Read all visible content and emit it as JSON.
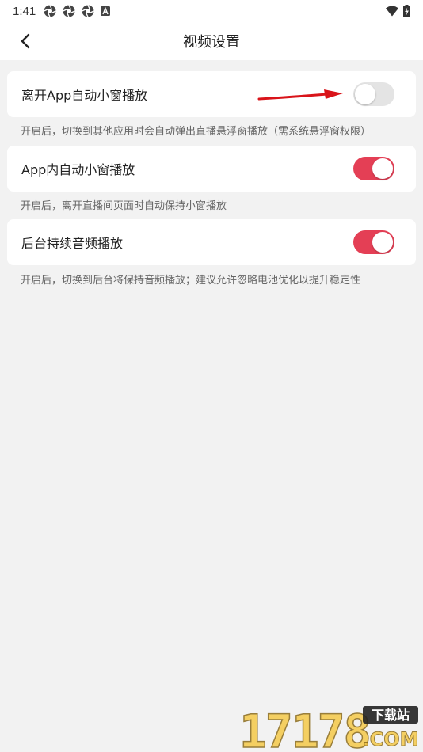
{
  "status_bar": {
    "time": "1:41",
    "left_icons": [
      "aperture-icon",
      "aperture-icon",
      "aperture-icon",
      "letter-a-box-icon"
    ],
    "right_icons": [
      "wifi-icon",
      "battery-charging-icon"
    ]
  },
  "header": {
    "back_icon": "chevron-left-icon",
    "title": "视频设置"
  },
  "settings": [
    {
      "label": "离开App自动小窗播放",
      "enabled": false,
      "description": "开启后，切换到其他应用时会自动弹出直播悬浮窗播放（需系统悬浮窗权限）"
    },
    {
      "label": "App内自动小窗播放",
      "enabled": true,
      "description": "开启后，离开直播间页面时自动保持小窗播放"
    },
    {
      "label": "后台持续音频播放",
      "enabled": true,
      "description": "开启后，切换到后台将保持音频播放；建议允许忽略电池优化以提升稳定性"
    }
  ],
  "annotation": {
    "icon": "red-arrow-icon",
    "color": "#d9141a"
  },
  "watermark": {
    "number": "17178",
    "text": "下载站",
    "domain": ".COM"
  },
  "colors": {
    "toggle_on": "#e43f55",
    "toggle_off": "#e4e4e4",
    "background": "#f2f2f2"
  }
}
